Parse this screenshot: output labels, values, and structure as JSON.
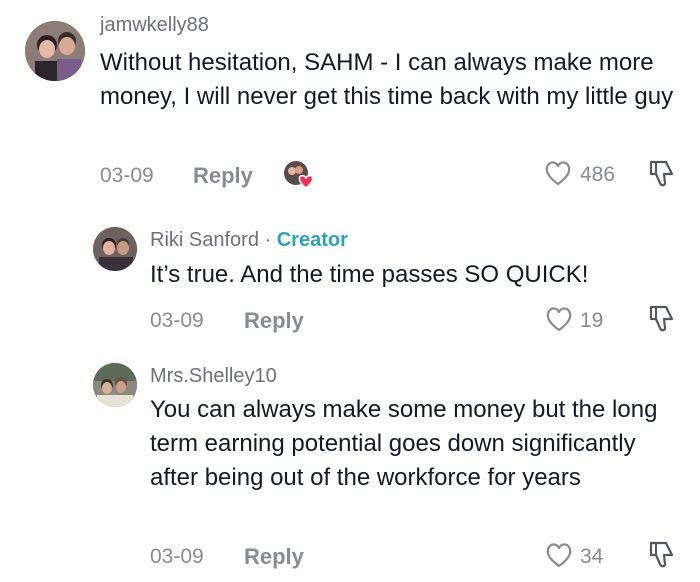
{
  "comments": [
    {
      "username": "jamwkelly88",
      "text": "Without hesitation, SAHM - I can always make more money, I will never get this time back with my little guy",
      "date": "03-09",
      "reply_label": "Reply",
      "likes": "486"
    }
  ],
  "replies": [
    {
      "username": "Riki Sanford",
      "separator": " · ",
      "badge": "Creator",
      "text": "It’s true. And the time passes SO QUICK!",
      "date": "03-09",
      "reply_label": "Reply",
      "likes": "19"
    },
    {
      "username": "Mrs.Shelley10",
      "text": "You can always make some money but the long term earning potential goes down significantly after being out of the workforce for years",
      "date": "03-09",
      "reply_label": "Reply",
      "likes": "34"
    }
  ],
  "icons": {
    "like": "heart-outline-icon",
    "dislike": "thumbs-down-icon",
    "creator_liked": "creator-liked-avatar-heart-icon"
  },
  "colors": {
    "creator_badge": "#2da3b3",
    "heart_badge": "#fe2c55",
    "meta_gray": "#8a8b91"
  }
}
